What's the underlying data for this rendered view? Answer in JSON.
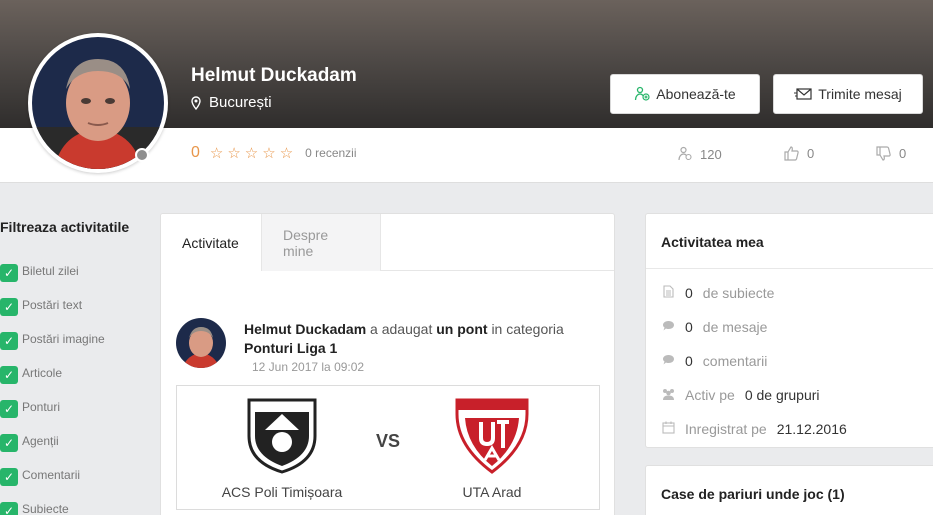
{
  "profile": {
    "name": "Helmut Duckadam",
    "location": "București",
    "rating": "0",
    "reviews": "0 recenzii",
    "followers": "120",
    "likes": "0",
    "dislikes": "0"
  },
  "actions": {
    "follow_label": "Abonează-te",
    "message_label": "Trimite mesaj"
  },
  "filters": {
    "title": "Filtreaza activitatile",
    "items": [
      "Biletul zilei",
      "Postări text",
      "Postări imagine",
      "Articole",
      "Ponturi",
      "Agenții",
      "Comentarii",
      "Subiecte"
    ]
  },
  "tabs": [
    "Activitate",
    "Despre mine"
  ],
  "post": {
    "author": "Helmut Duckadam",
    "action": "a adaugat",
    "object": "un pont",
    "category_prefix": "in categoria",
    "category": "Ponturi Liga 1",
    "date": "12 Jun 2017 la 09:02",
    "home_team": "ACS Poli Timișoara",
    "away_team": "UTA Arad",
    "vs": "VS"
  },
  "activity": {
    "title": "Activitatea mea",
    "subjects_count": "0",
    "subjects_label": "de subiecte",
    "messages_count": "0",
    "messages_label": "de mesaje",
    "comments_count": "0",
    "comments_label": "comentarii",
    "groups_prefix": "Activ pe",
    "groups_count": "0 de grupuri",
    "registered_prefix": "Inregistrat pe",
    "registered_date": "21.12.2016"
  },
  "bookmakers": {
    "title": "Case de pariuri unde joc (1)"
  },
  "colors": {
    "accent_green": "#27b56a",
    "rating_orange": "#e8964a"
  }
}
